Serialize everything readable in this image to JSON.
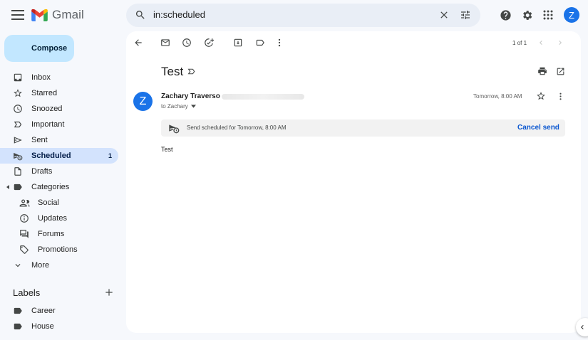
{
  "app": {
    "name": "Gmail"
  },
  "search": {
    "query": "in:scheduled"
  },
  "account": {
    "avatar_letter": "Z"
  },
  "compose": {
    "label": "Compose"
  },
  "sidebar": {
    "items": [
      {
        "label": "Inbox"
      },
      {
        "label": "Starred"
      },
      {
        "label": "Snoozed"
      },
      {
        "label": "Important"
      },
      {
        "label": "Sent"
      },
      {
        "label": "Scheduled",
        "count": "1"
      },
      {
        "label": "Drafts"
      },
      {
        "label": "Categories"
      },
      {
        "label": "Social"
      },
      {
        "label": "Updates"
      },
      {
        "label": "Forums"
      },
      {
        "label": "Promotions"
      },
      {
        "label": "More"
      }
    ],
    "labels_title": "Labels",
    "labels": [
      {
        "label": "Career"
      },
      {
        "label": "House"
      }
    ]
  },
  "toolbar": {
    "pager": "1 of 1"
  },
  "email": {
    "subject": "Test",
    "sender_name": "Zachary Traverso",
    "sender_avatar_letter": "Z",
    "to_line": "to Zachary",
    "date": "Tomorrow, 8:00 AM",
    "scheduled_notice": "Send scheduled for Tomorrow, 8:00 AM",
    "cancel_label": "Cancel send",
    "body": "Test"
  },
  "colors": {
    "accent": "#0b57d0",
    "compose_bg": "#c2e7ff",
    "active_bg": "#d3e3fd",
    "avatar": "#1a73e8"
  }
}
